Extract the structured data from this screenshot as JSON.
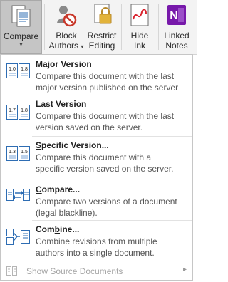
{
  "ribbon": {
    "compare_label": "Compare",
    "block_authors_label_1": "Block",
    "block_authors_label_2": "Authors",
    "restrict_editing_label_1": "Restrict",
    "restrict_editing_label_2": "Editing",
    "hide_ink_label_1": "Hide",
    "hide_ink_label_2": "Ink",
    "linked_notes_label_1": "Linked",
    "linked_notes_label_2": "Notes",
    "dropdown_caret": "▾"
  },
  "menu": {
    "items": [
      {
        "icon": "compare-versions-icon",
        "icon_left": "1.0",
        "icon_right": "1.8",
        "title_access": "M",
        "title_rest": "ajor Version",
        "desc_1": "Compare this document with the last",
        "desc_2": "major version published on the server"
      },
      {
        "icon": "compare-versions-icon",
        "icon_left": "1.7",
        "icon_right": "1.8",
        "title_access": "L",
        "title_rest": "ast Version",
        "desc_1": "Compare this document with the last",
        "desc_2": "version saved on the server."
      },
      {
        "icon": "compare-versions-icon",
        "icon_left": "1.3",
        "icon_right": "1.5",
        "title_access": "S",
        "title_rest": "pecific Version...",
        "desc_1": "Compare this document with a",
        "desc_2": "specific version saved on the server."
      },
      {
        "icon": "compare-documents-icon",
        "title_access": "C",
        "title_rest": "ompare...",
        "desc_1": "Compare two versions of a document",
        "desc_2": "(legal blackline)."
      },
      {
        "icon": "combine-documents-icon",
        "title_pre": "Com",
        "title_access": "b",
        "title_rest": "ine...",
        "desc_1": "Combine revisions from multiple",
        "desc_2": "authors into a single document."
      }
    ],
    "footer_label": "Show Source Documents",
    "footer_arrow": "▸"
  },
  "colors": {
    "onenote_purple": "#7719aa",
    "block_red": "#c8392b",
    "lock_gold": "#e2b33a",
    "ink_red": "#d9232e",
    "doc_blue": "#2e6db3"
  }
}
